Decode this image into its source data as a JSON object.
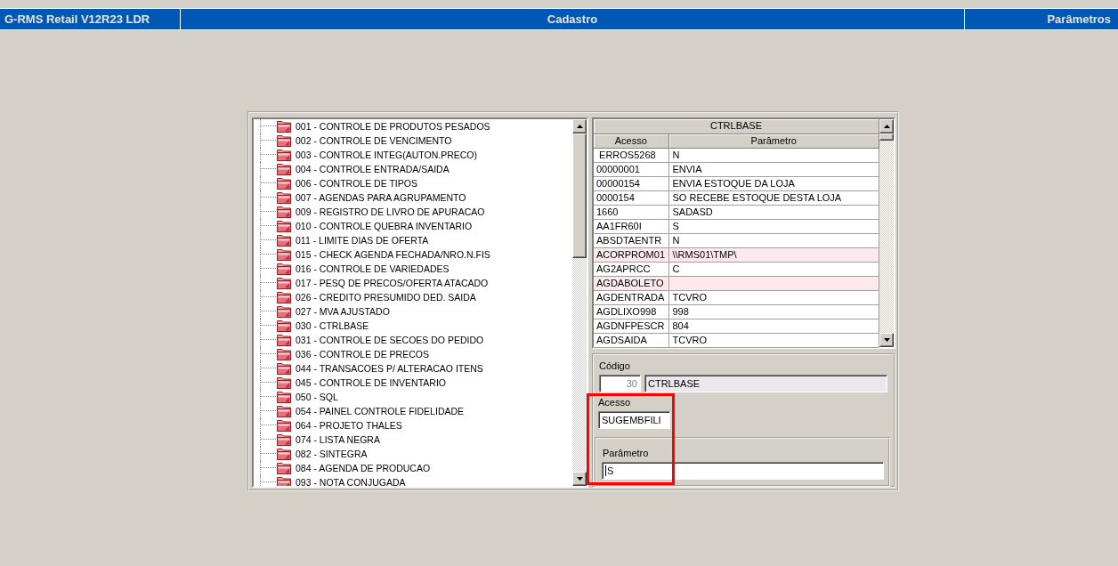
{
  "title_bar": {
    "app_name": "G-RMS Retail V12R23 LDR",
    "module": "Cadastro",
    "screen": "Parâmetros"
  },
  "tree": {
    "items": [
      {
        "label": "001 - CONTROLE DE PRODUTOS PESADOS",
        "selected": false
      },
      {
        "label": "002 - CONTROLE DE VENCIMENTO",
        "selected": false
      },
      {
        "label": "003 - CONTROLE INTEG(AUTON.PRECO)",
        "selected": false
      },
      {
        "label": "004 - CONTROLE ENTRADA/SAIDA",
        "selected": false
      },
      {
        "label": "006 - CONTROLE DE TIPOS",
        "selected": false
      },
      {
        "label": "007 - AGENDAS PARA AGRUPAMENTO",
        "selected": false
      },
      {
        "label": "009 - REGISTRO DE LIVRO DE APURACAO",
        "selected": false
      },
      {
        "label": "010 - CONTROLE QUEBRA INVENTARIO",
        "selected": false
      },
      {
        "label": "011 - LIMITE DIAS DE OFERTA",
        "selected": false
      },
      {
        "label": "015 - CHECK AGENDA FECHADA/NRO.N.FIS",
        "selected": false
      },
      {
        "label": "016 - CONTROLE DE VARIEDADES",
        "selected": false
      },
      {
        "label": "017 - PESQ DE PRECOS/OFERTA ATACADO",
        "selected": false
      },
      {
        "label": "026 - CREDITO PRESUMIDO DED. SAIDA",
        "selected": false
      },
      {
        "label": "027 - MVA AJUSTADO",
        "selected": false
      },
      {
        "label": "030 - CTRLBASE",
        "selected": false
      },
      {
        "label": "031 - CONTROLE DE SECOES DO PEDIDO",
        "selected": false
      },
      {
        "label": "036 - CONTROLE DE PRECOS",
        "selected": false
      },
      {
        "label": "044 - TRANSACOES P/ ALTERACAO ITENS",
        "selected": false
      },
      {
        "label": "045 - CONTROLE DE INVENTARIO",
        "selected": false
      },
      {
        "label": "050 - SQL",
        "selected": false
      },
      {
        "label": "054 - PAINEL CONTROLE FIDELIDADE",
        "selected": false
      },
      {
        "label": "064 - PROJETO THALES",
        "selected": false
      },
      {
        "label": "074 - LISTA NEGRA",
        "selected": false
      },
      {
        "label": "082 - SINTEGRA",
        "selected": false
      },
      {
        "label": "084 - AGENDA DE PRODUCAO",
        "selected": false
      },
      {
        "label": "093 - NOTA CONJUGADA",
        "selected": false
      }
    ]
  },
  "grid": {
    "title": "CTRLBASE",
    "columns": [
      "Acesso",
      "Parâmetro"
    ],
    "rows": [
      {
        "acesso": " ERROS5268",
        "parametro": "N",
        "highlighted": false
      },
      {
        "acesso": "00000001",
        "parametro": "ENVIA",
        "highlighted": false
      },
      {
        "acesso": "00000154",
        "parametro": "ENVIA ESTOQUE DA LOJA",
        "highlighted": false
      },
      {
        "acesso": "0000154",
        "parametro": "SO RECEBE ESTOQUE DESTA LOJA",
        "highlighted": false
      },
      {
        "acesso": "1660",
        "parametro": "SADASD",
        "highlighted": false
      },
      {
        "acesso": "AA1FR60I",
        "parametro": "S",
        "highlighted": false
      },
      {
        "acesso": "ABSDTAENTR",
        "parametro": "N",
        "highlighted": false
      },
      {
        "acesso": "ACORPROM01",
        "parametro": "\\\\RMS01\\TMP\\",
        "highlighted": true
      },
      {
        "acesso": "AG2APRCC",
        "parametro": "C",
        "highlighted": false
      },
      {
        "acesso": "AGDABOLETO",
        "highlighted": true
      },
      {
        "acesso": "AGDENTRADA",
        "parametro": "TCVRO",
        "highlighted": false
      },
      {
        "acesso": "AGDLIXO998",
        "parametro": "998",
        "highlighted": false
      },
      {
        "acesso": "AGDNFPESCR",
        "parametro": "804",
        "highlighted": false
      },
      {
        "acesso": "AGDSAIDA",
        "parametro": "TCVRO",
        "highlighted": false
      }
    ]
  },
  "form": {
    "codigo": {
      "label": "Código",
      "number": "30",
      "description": "CTRLBASE",
      "disabled": true
    },
    "acesso": {
      "label": "Acesso",
      "value": "SUGEMBFILI"
    },
    "parametro": {
      "label": "Parâmetro",
      "value": "S",
      "focused": true
    }
  },
  "annotations": [
    {
      "kind": "rectangle"
    }
  ]
}
